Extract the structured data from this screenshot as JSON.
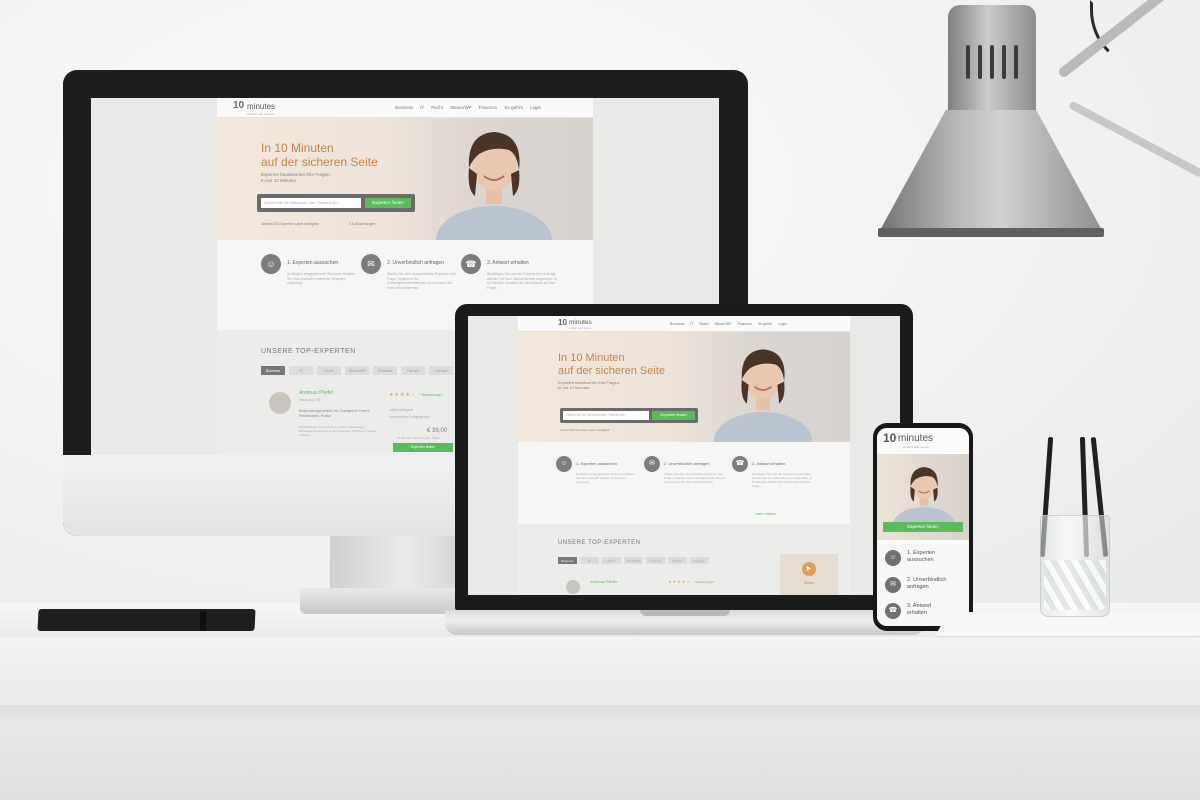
{
  "site": {
    "logo_number": "10",
    "logo_word": "minutes",
    "logo_tagline": "einfach. klar. besser.",
    "nav": [
      "Business",
      "IT",
      "Recht",
      "Steuer/WP",
      "Finanzen",
      "So geht's",
      "Login"
    ],
    "hero_title_line1": "In 10 Minuten",
    "hero_title_line2": "auf der sicheren Seite",
    "hero_sub_line1": "Experten beantworten Ihre Fragen.",
    "hero_sub_line2": "In nur 10 Minuten.",
    "search_placeholder": "Geben Sie Ihr Stichwort oder Themen ein",
    "search_button": "Experten finden",
    "hero_note_left": "Aktuell 233 Experten sofort verfügbar",
    "hero_note_right": "3,9 Bewertungen",
    "steps": [
      {
        "title": "1. Experten aussuchen",
        "text": "Zu Beginn eingegebenen Stichwort erhalten Sie eine Auswahl erfahrener Experten angezeigt."
      },
      {
        "title": "2. Unverbindlich anfragen",
        "text": "Stellen Sie dem ausgewählten Experten Ihre Frage, ergänzen Sie Unterlagen/Informationen und nennen Sie Ihren Wunschtermin."
      },
      {
        "title": "3. Antwort erhalten",
        "text": "Bestätigen Sie und der Experte Ihre Anfrage, werden Sie zum Wunschtermin angerufen. In 10 Minuten erhalten Sie die Antwort auf Ihre Frage."
      }
    ],
    "more_link": "mehr erfahren",
    "experts_title": "UNSERE TOP-EXPERTEN",
    "tabs": [
      "Business",
      "IT",
      "Recht",
      "Steuer/WP",
      "Finanzen",
      "Themen",
      "Themen"
    ],
    "expert_name": "Andreas Pfeifer",
    "expert_location": "Hamburg, DE",
    "expert_desc": "Branchenspezialist für Gastgeber Hotel, Restaurant, Kultur",
    "expert_stars": "★★★★☆",
    "expert_reviews": "7 Bewertungen",
    "expert_available": "sofort verfügbar",
    "expert_free": "kostenfreies Erstgespräch",
    "expert_price": "€ 39,00",
    "expert_price_note": "10 Minuten-Beratung inkl. MwSt",
    "expert_tags": "Social Media | Außenwerbung | Event-Marketing | Personalentwicklung | Direkt-marketing | Werbung | Hotels | Marken",
    "video_label": "Video",
    "phone_button": "Experten finden",
    "phone_steps": [
      {
        "line1": "1. Experten",
        "line2": "aussuchen"
      },
      {
        "line1": "2. Unverbindlich",
        "line2": "anfragen"
      },
      {
        "line1": "3. Antwort",
        "line2": "erhalten"
      }
    ]
  },
  "colors": {
    "accent_orange": "#c2834f",
    "accent_green": "#5bbb5b",
    "hero_bg": "#efe5db",
    "device_black": "#1e1e1e"
  },
  "icons": {
    "step1": "person-search-icon",
    "step2": "chat-bubble-icon",
    "step3": "phone-call-icon",
    "lock": "lock-icon",
    "info": "info-icon"
  }
}
